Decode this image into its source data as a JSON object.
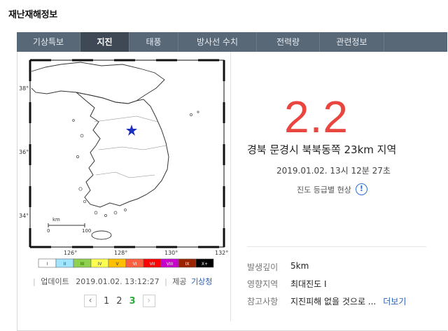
{
  "page": {
    "title": "재난재해정보"
  },
  "tabs": [
    {
      "label": "기상특보",
      "active": false
    },
    {
      "label": "지진",
      "active": true
    },
    {
      "label": "태풍",
      "active": false
    },
    {
      "label": "방사선 수치",
      "active": false
    },
    {
      "label": "전력량",
      "active": false
    },
    {
      "label": "관련정보",
      "active": false
    }
  ],
  "map": {
    "lat_labels": [
      "38°",
      "36°",
      "34°"
    ],
    "lon_labels": [
      "126°",
      "128°",
      "130°",
      "132°"
    ],
    "scale_label": "km",
    "scale_ticks": [
      "0",
      "100"
    ],
    "intensity_scale": [
      "I",
      "II",
      "III",
      "IV",
      "V",
      "VI",
      "VII",
      "VIII",
      "IX",
      "X+"
    ],
    "intensity_colors": [
      "#ffffff",
      "#a0e6ff",
      "#90d050",
      "#ffff50",
      "#ffc000",
      "#ff6040",
      "#ff0000",
      "#cc00cc",
      "#992200",
      "#000000"
    ],
    "epicenter_icon": "star-icon"
  },
  "update": {
    "label": "업데이트",
    "datetime": "2019.01.02. 13:12:27",
    "separator": "|",
    "provider_label": "제공",
    "provider": "기상청"
  },
  "pagination": {
    "prev_icon": "chevron-left-icon",
    "next_icon": "chevron-right-icon",
    "pages": [
      "1",
      "2",
      "3"
    ],
    "current": "3"
  },
  "quake": {
    "magnitude": "2.2",
    "location": "경북 문경시 북북동쪽 23km 지역",
    "datetime": "2019.01.02. 13시 12분 27초",
    "intensity_link": "진도 등급별 현상",
    "info_icon": "info-icon",
    "magnitude_color": "#e8463f"
  },
  "details": [
    {
      "label": "발생깊이",
      "value": "5km"
    },
    {
      "label": "영향지역",
      "value": "최대진도 Ⅰ"
    },
    {
      "label": "참고사항",
      "value": "지진피해 없을 것으로 ...",
      "more": "더보기"
    }
  ]
}
